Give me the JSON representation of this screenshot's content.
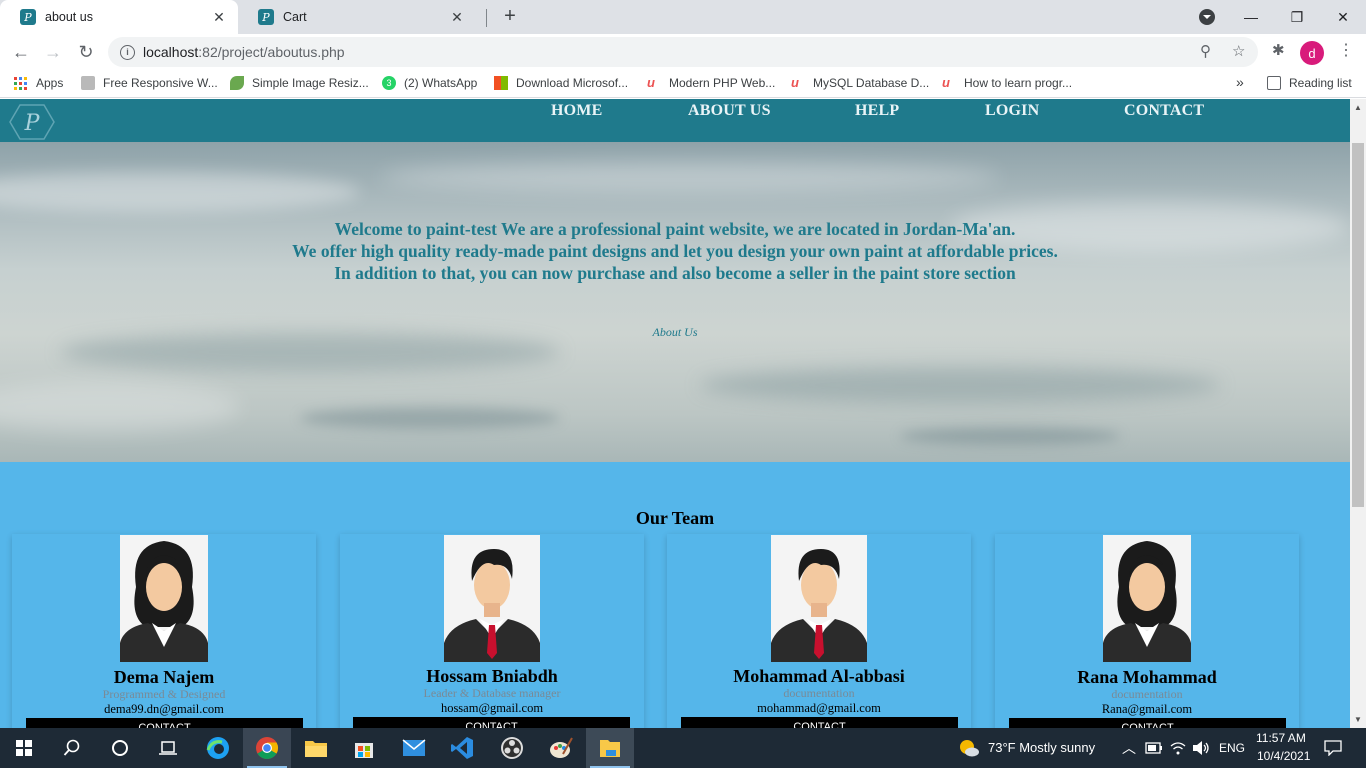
{
  "browser": {
    "tabs": [
      {
        "title": "about us",
        "active": true
      },
      {
        "title": "Cart",
        "active": false
      }
    ],
    "url_host": "localhost",
    "url_path": ":82/project/aboutus.php",
    "profile_initial": "d",
    "bookmarks": [
      {
        "label": "Apps",
        "icon": "apps-grid-icon"
      },
      {
        "label": "Free Responsive W...",
        "icon": "site-icon"
      },
      {
        "label": "Simple Image Resiz...",
        "icon": "leaf-icon"
      },
      {
        "label": "(2) WhatsApp",
        "icon": "whatsapp-icon",
        "badge": "3"
      },
      {
        "label": "Download Microsof...",
        "icon": "microsoft-icon"
      },
      {
        "label": "Modern PHP Web...",
        "icon": "udemy-icon"
      },
      {
        "label": "MySQL Database D...",
        "icon": "udemy-icon"
      },
      {
        "label": "How to learn progr...",
        "icon": "udemy-icon"
      }
    ],
    "bookmarks_overflow": "»",
    "reading_list": "Reading list"
  },
  "site": {
    "logo_letter": "P",
    "nav": [
      "HOME",
      "ABOUT US",
      "HELP",
      "LOGIN",
      "CONTACT"
    ],
    "hero": {
      "line1": "Welcome to paint-test We are a professional paint website, we are located in Jordan-Ma'an.",
      "line2": "We offer high quality ready-made paint designs and let you design your own paint at affordable prices.",
      "line3": "In addition to that, you can now purchase and also become a seller in the paint store section",
      "subtitle": "About Us"
    },
    "team_title": "Our Team",
    "members": [
      {
        "name": "Dema Najem",
        "role": "Programmed & Designed",
        "email": "dema99.dn@gmail.com",
        "button": "CONTACT",
        "gender": "female"
      },
      {
        "name": "Hossam Bniabdh",
        "role": "Leader & Database manager",
        "email": "hossam@gmail.com",
        "button": "CONTACT",
        "gender": "male"
      },
      {
        "name": "Mohammad Al-abbasi",
        "role": "documentation",
        "email": "mohammad@gmail.com",
        "button": "CONTACT",
        "gender": "male"
      },
      {
        "name": "Rana Mohammad",
        "role": "documentation",
        "email": "Rana@gmail.com",
        "button": "CONTACT",
        "gender": "female"
      }
    ]
  },
  "taskbar": {
    "weather": "73°F  Mostly sunny",
    "language": "ENG",
    "time": "11:57 AM",
    "date": "10/4/2021"
  },
  "colors": {
    "nav_bg": "#1f7a8c",
    "team_bg": "#55b6ea",
    "taskbar_bg": "#1e2a36"
  }
}
